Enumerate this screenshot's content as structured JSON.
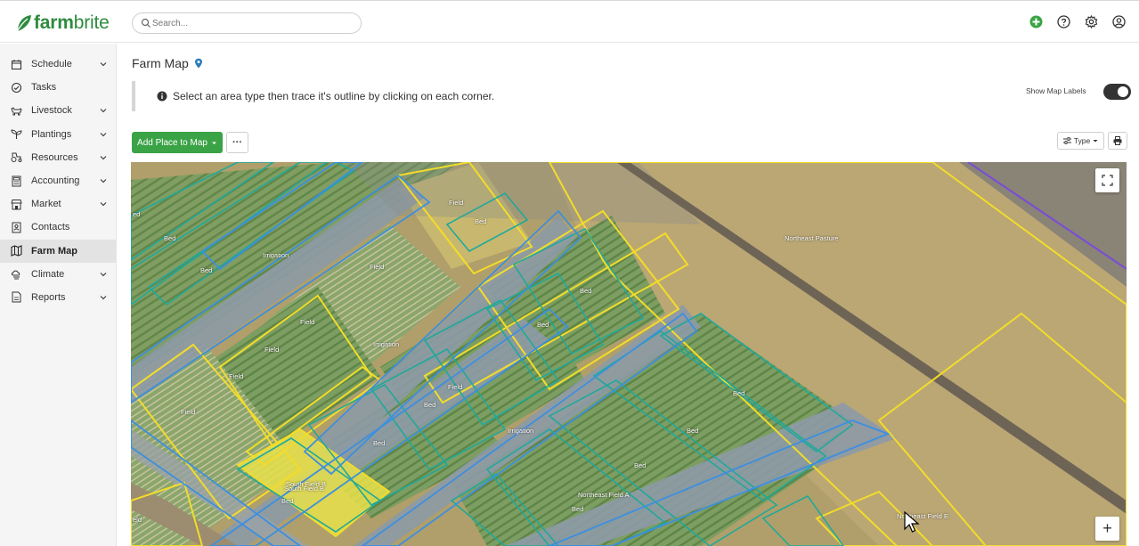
{
  "app": {
    "logo_bold": "farm",
    "logo_rest": "brite",
    "brand_color": "#2e8b3e"
  },
  "search": {
    "placeholder": "Search..."
  },
  "top_icons": [
    "add-circle-icon",
    "help-icon",
    "settings-gear-icon",
    "account-icon"
  ],
  "sidebar": {
    "items": [
      {
        "label": "Schedule",
        "icon": "calendar-icon",
        "has_chevron": true
      },
      {
        "label": "Tasks",
        "icon": "check-circle-icon",
        "has_chevron": false
      },
      {
        "label": "Livestock",
        "icon": "livestock-icon",
        "has_chevron": true
      },
      {
        "label": "Plantings",
        "icon": "sprout-icon",
        "has_chevron": true
      },
      {
        "label": "Resources",
        "icon": "tractor-icon",
        "has_chevron": true
      },
      {
        "label": "Accounting",
        "icon": "calculator-icon",
        "has_chevron": true
      },
      {
        "label": "Market",
        "icon": "store-icon",
        "has_chevron": true
      },
      {
        "label": "Contacts",
        "icon": "contacts-icon",
        "has_chevron": false
      },
      {
        "label": "Farm Map",
        "icon": "map-icon",
        "has_chevron": false,
        "active": true
      },
      {
        "label": "Climate",
        "icon": "weather-icon",
        "has_chevron": true
      },
      {
        "label": "Reports",
        "icon": "report-icon",
        "has_chevron": true
      }
    ]
  },
  "page": {
    "title": "Farm Map",
    "info_text": "Select an area type then trace it's outline by clicking on each corner.",
    "show_labels_text": "Show Map Labels",
    "show_labels_on": true,
    "add_button": "Add Place to Map",
    "more_button": "···",
    "type_button": "Type",
    "accent_green": "#3aa346"
  },
  "map": {
    "labels": [
      "Field",
      "Bed",
      "Northeast Pasture",
      "Irrigation",
      "Field",
      "Bed",
      "Bed",
      "Bed",
      "Field",
      "Bed",
      "Irrigation",
      "Field",
      "Field",
      "Field",
      "Bed",
      "Field",
      "Bed",
      "Irrigation",
      "Bed",
      "Bed",
      "Bed",
      "South Field B",
      "South Field B",
      "Northeast Field A",
      "Bed",
      "Northeast Field E",
      "Bed",
      "eld",
      "ed"
    ],
    "zoom_button": "+",
    "colors": {
      "field_outline": "#f2dc2a",
      "bed_outline": "#1fa99a",
      "irrigation_outline": "#3d8fe0",
      "pasture_outline": "#f2dc2a",
      "boundary": "#7a4fd1"
    }
  }
}
